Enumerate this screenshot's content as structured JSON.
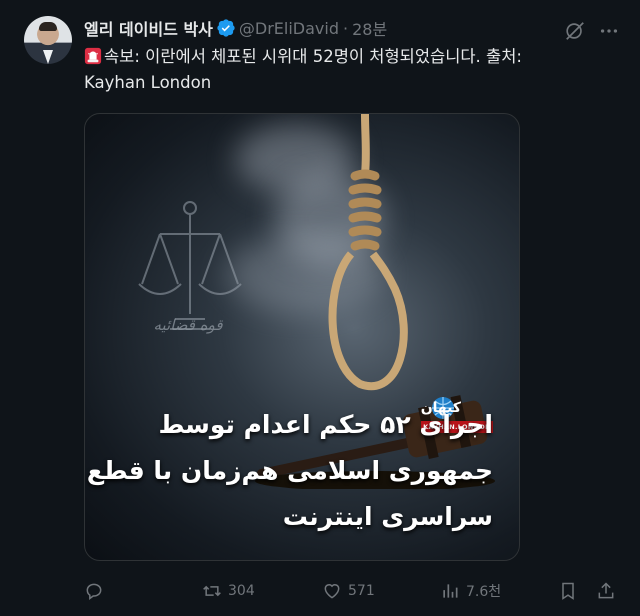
{
  "author": {
    "name": "엘리 데이비드 박사",
    "handle": "@DrEliDavid",
    "separator": "·",
    "time": "28분",
    "verified": true
  },
  "tweet": {
    "text_line1": "속보: 이란에서 체포된 시위대 52명이 처형되었습니다. 출처:",
    "text_line2": "Kayhan London",
    "emoji": "siren-emoji"
  },
  "media": {
    "logo_persian": "کیهان",
    "logo_english": "KAYHAN.LONDON",
    "scales_caption": "قوه قضائیه",
    "headline": [
      "اجرای ۵۲ حکم اعدام توسط",
      "جمهوری اسلامی هم‌زمان با قطع",
      "سراسری اینترنت"
    ]
  },
  "actions": {
    "replies": "",
    "retweets": "304",
    "likes": "571",
    "views": "7.6천"
  },
  "colors": {
    "background": "#0f1419",
    "text": "#e7e9ea",
    "muted": "#71767b",
    "verified": "#1d9bf0",
    "logo_red": "#b9141a"
  },
  "icons": [
    "grok-icon",
    "more-icon",
    "reply-icon",
    "retweet-icon",
    "like-icon",
    "views-icon",
    "bookmark-icon",
    "share-icon"
  ]
}
